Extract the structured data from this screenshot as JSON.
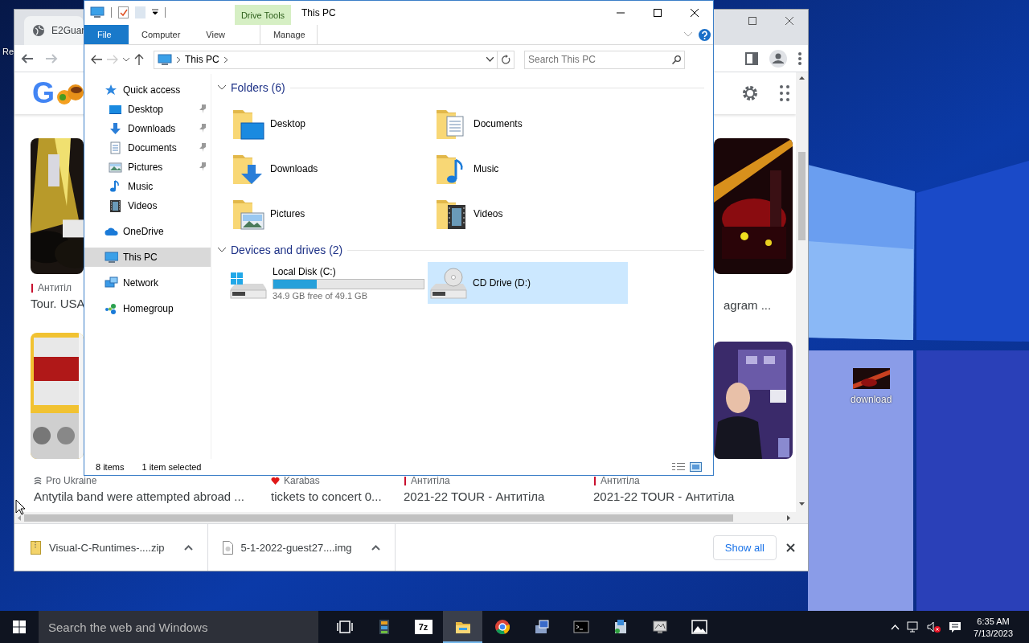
{
  "desktop": {
    "icons": [
      {
        "label": "Re",
        "kind": "cut"
      },
      {
        "label": "download"
      }
    ]
  },
  "browser": {
    "tab": {
      "title": "E2Guar"
    },
    "logo": "G",
    "cards": [
      {
        "source": "Антитіл",
        "kind": "antytila",
        "title": "Tour. USA"
      },
      {
        "title": "agram ..."
      }
    ],
    "bottom_cards": [
      {
        "source": "Pro Ukraine",
        "kind": "proukraine",
        "title": "Antytila band were attempted abroad ..."
      },
      {
        "source": "Karabas",
        "kind": "karabas",
        "title": "tickets to concert 0..."
      },
      {
        "source": "Антитіла",
        "kind": "antytila",
        "title": "2021-22 TOUR - Антитіла"
      },
      {
        "source": "Антитіла",
        "kind": "antytila",
        "title": "2021-22 TOUR - Антитіла"
      }
    ],
    "downloads": [
      {
        "name": "Visual-C-Runtimes-....zip",
        "kind": "zip"
      },
      {
        "name": "5-1-2022-guest27....img",
        "kind": "img"
      }
    ],
    "show_all": "Show all"
  },
  "explorer": {
    "title": "This PC",
    "context_tab": "Drive Tools",
    "ribbon_tabs": [
      {
        "label": "File",
        "kind": "file"
      },
      {
        "label": "Computer",
        "kind": "tab"
      },
      {
        "label": "View",
        "kind": "tab"
      },
      {
        "label": "Manage",
        "kind": "context"
      }
    ],
    "address": "This PC",
    "search": {
      "placeholder": "Search This PC"
    },
    "nav": [
      {
        "label": "Quick access",
        "kind": "star",
        "selected": false,
        "children": [
          {
            "label": "Desktop",
            "kind": "desktop",
            "pinned": true,
            "selected": false
          },
          {
            "label": "Downloads",
            "kind": "downloads",
            "pinned": true,
            "selected": false
          },
          {
            "label": "Documents",
            "kind": "documents",
            "pinned": true,
            "selected": false
          },
          {
            "label": "Pictures",
            "kind": "pictures",
            "pinned": true,
            "selected": false
          },
          {
            "label": "Music",
            "kind": "music",
            "pinned": false,
            "selected": false
          },
          {
            "label": "Videos",
            "kind": "videos",
            "pinned": false,
            "selected": false
          }
        ]
      },
      {
        "label": "OneDrive",
        "kind": "cloud",
        "selected": false
      },
      {
        "label": "This PC",
        "kind": "pc",
        "selected": true
      },
      {
        "label": "Network",
        "kind": "network",
        "selected": false
      },
      {
        "label": "Homegroup",
        "kind": "homegroup",
        "selected": false
      }
    ],
    "folders_header": "Folders (6)",
    "folders": [
      {
        "label": "Desktop",
        "kind": "desktop"
      },
      {
        "label": "Documents",
        "kind": "documents"
      },
      {
        "label": "Downloads",
        "kind": "downloads"
      },
      {
        "label": "Music",
        "kind": "music"
      },
      {
        "label": "Pictures",
        "kind": "pictures"
      },
      {
        "label": "Videos",
        "kind": "videos"
      }
    ],
    "drives_header": "Devices and drives (2)",
    "drives": [
      {
        "label": "Local Disk (C:)",
        "kind": "hdd",
        "level": 0.29,
        "free": "34.9 GB free of 49.1 GB",
        "selected": false
      },
      {
        "label": "CD Drive (D:)",
        "kind": "cd",
        "selected": true
      }
    ],
    "status": {
      "items": "8 items",
      "selection": "1 item selected"
    }
  },
  "taskbar": {
    "search": {
      "placeholder": "Search the web and Windows"
    },
    "apps": [
      {
        "kind": "taskview",
        "active": false
      },
      {
        "kind": "tiles",
        "active": false
      },
      {
        "kind": "archiver",
        "label": "7z",
        "active": false
      },
      {
        "kind": "explorer",
        "active": true
      },
      {
        "kind": "chrome",
        "active": false
      },
      {
        "kind": "netapp",
        "active": false
      },
      {
        "kind": "terminal",
        "active": false
      },
      {
        "kind": "installer",
        "active": false
      },
      {
        "kind": "monitor",
        "active": false
      },
      {
        "kind": "photos",
        "active": false
      }
    ],
    "time": "6:35 AM",
    "date": "7/13/2023"
  }
}
